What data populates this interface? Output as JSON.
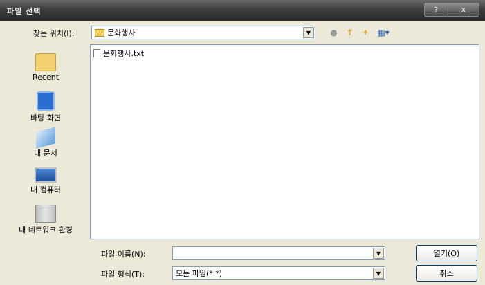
{
  "window": {
    "title": "파일 선택",
    "help_label": "?",
    "close_label": "x"
  },
  "lookin": {
    "label": "찾는 위치(I):",
    "value": "문화행사"
  },
  "toolbar": {
    "back_icon": "back-arrow-icon",
    "up_icon": "up-folder-icon",
    "new_folder_icon": "new-folder-icon",
    "views_icon": "views-menu-icon"
  },
  "places": [
    {
      "label": "Recent"
    },
    {
      "label": "바탕 화면"
    },
    {
      "label": "내 문서"
    },
    {
      "label": "내 컴퓨터"
    },
    {
      "label": "내 네트워크 환경"
    }
  ],
  "files": [
    {
      "name": "문화행사.txt"
    }
  ],
  "filename": {
    "label": "파일 이름(N):",
    "value": ""
  },
  "filetype": {
    "label": "파일 형식(T):",
    "value": "모든 파일(*.*)"
  },
  "buttons": {
    "open": "열기(O)",
    "cancel": "취소"
  },
  "colors": {
    "titlebar": "#2b2b2b",
    "dialog_bg": "#ece9d8",
    "border": "#7f9db9"
  }
}
